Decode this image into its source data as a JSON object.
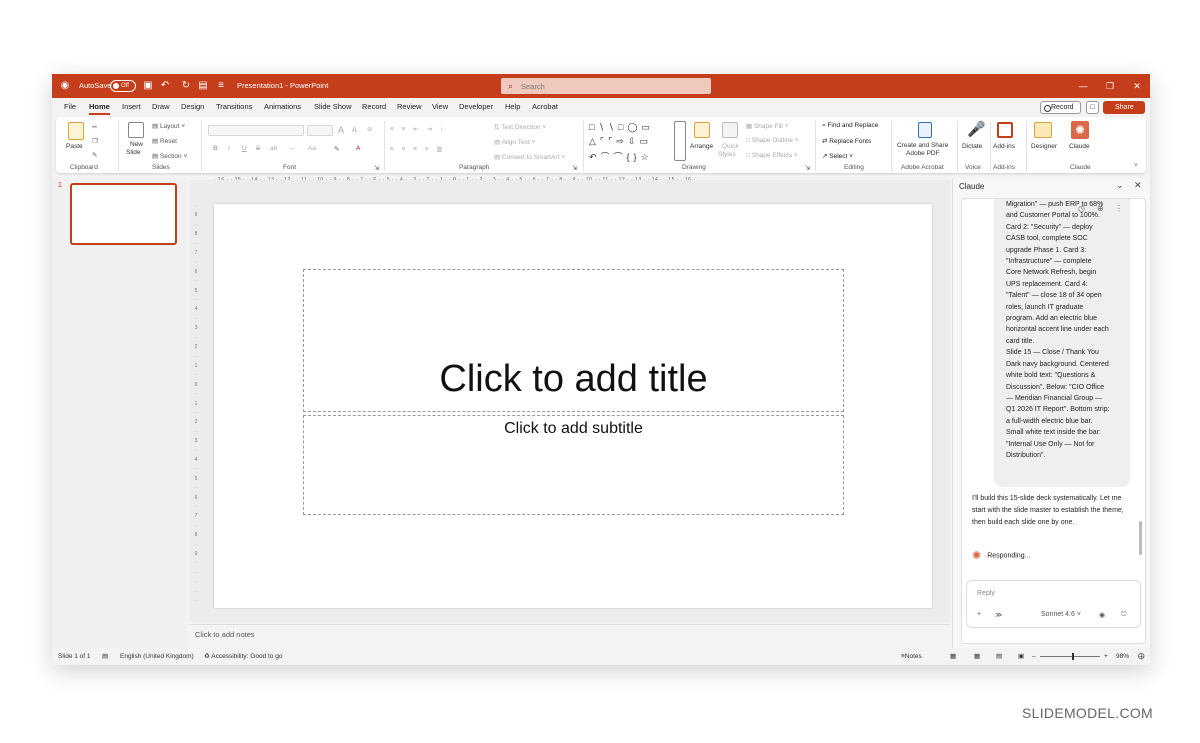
{
  "titlebar": {
    "autosave_label": "AutoSave",
    "autosave_state": "Off",
    "doc_title": "Presentation1 - PowerPoint",
    "search_placeholder": "Search"
  },
  "menu": {
    "tabs": [
      "File",
      "Home",
      "Insert",
      "Draw",
      "Design",
      "Transitions",
      "Animations",
      "Slide Show",
      "Record",
      "Review",
      "View",
      "Developer",
      "Help",
      "Acrobat"
    ],
    "active": "Home",
    "record_label": "Record",
    "share_label": "Share"
  },
  "ribbon": {
    "clipboard": {
      "paste": "Paste",
      "group": "Clipboard"
    },
    "slides": {
      "new_slide_1": "New",
      "new_slide_2": "Slide",
      "layout": "Layout",
      "reset": "Reset",
      "section": "Section",
      "group": "Slides"
    },
    "font": {
      "group": "Font",
      "bold": "B",
      "italic": "I",
      "underline": "U",
      "strike": "S",
      "grow": "A",
      "shrink": "A",
      "case": "Aa"
    },
    "paragraph": {
      "text_direction": "Text Direction",
      "align_text": "Align Text",
      "convert_smartart": "Convert to SmartArt",
      "group": "Paragraph"
    },
    "drawing": {
      "arrange": "Arrange",
      "quick_styles_1": "Quick",
      "quick_styles_2": "Styles",
      "shape_fill": "Shape Fill",
      "shape_outline": "Shape Outline",
      "shape_effects": "Shape Effects",
      "group": "Drawing"
    },
    "editing": {
      "find_replace": "Find and Replace",
      "replace_fonts": "Replace Fonts",
      "select": "Select",
      "group": "Editing"
    },
    "adobe": {
      "create_share_1": "Create and Share",
      "create_share_2": "Adobe PDF",
      "group": "Adobe Acrobat"
    },
    "voice": {
      "dictate": "Dictate",
      "group": "Voice"
    },
    "addins": {
      "addins": "Add-ins",
      "group": "Add-ins"
    },
    "designer": {
      "designer": "Designer"
    },
    "claude": {
      "claude": "Claude",
      "group": "Claude"
    }
  },
  "ruler": {
    "horizontal": "· 16 · · 15 · · 14 · · 13 · · 12 · · 11 · · 10 · · 9 · · 8 · · 7 · · 6 · · 5 · · 4 · · 3 · · 2 · · 1 · · 0 · · 1 · · 2 · · 3 · · 4 · · 5 · · 6 · · 7 · · 8 · · 9 · · 10 · · 11 · · 12 · · 13 · · 14 · · 15 · · 16 ·",
    "vertical": [
      "·",
      "9",
      "·",
      "8",
      "·",
      "7",
      "·",
      "6",
      "·",
      "5",
      "·",
      "4",
      "·",
      "3",
      "·",
      "2",
      "·",
      "1",
      "·",
      "0",
      "·",
      "1",
      "·",
      "2",
      "·",
      "3",
      "·",
      "4",
      "·",
      "5",
      "·",
      "6",
      "·",
      "7",
      "·",
      "8",
      "·",
      "9",
      "·",
      "·",
      "·",
      "·",
      "·",
      "·"
    ]
  },
  "slides_panel": {
    "slide_number": "1"
  },
  "slide": {
    "title_placeholder": "Click to add title",
    "subtitle_placeholder": "Click to add subtitle"
  },
  "notes_placeholder": "Click to add notes",
  "claude_panel": {
    "header": "Claude",
    "prompt_excerpt": "Migration\" — push ERP to 68%\nand Customer Portal to 100%.\nCard 2: \"Security\" — deploy\nCASB tool, complete SOC\nupgrade Phase 1. Card 3:\n\"Infrastructure\" — complete\nCore Network Refresh, begin\nUPS replacement. Card 4:\n\"Talent\" — close 18 of 34 open\nroles, launch IT graduate\nprogram. Add an electric blue\nhorizontal accent line under each\ncard title.\nSlide 15 — Close / Thank You\nDark navy background. Centered\nwhite bold text: \"Questions &\nDiscussion\". Below: \"CIO Office\n— Meridian Financial Group —\nQ1 2026 IT Report\". Bottom strip:\na full-width electric blue bar.\nSmall white text inside the bar:\n\"Internal Use Only — Not for\nDistribution\".",
    "assistant_reply": "I'll build this 15-slide deck systematically. Let me start with the slide master to establish the theme, then build each slide one by one.",
    "status": "Responding...",
    "reply_placeholder": "Reply",
    "model": "Sonnet 4.6"
  },
  "statusbar": {
    "slide_of": "Slide 1 of 1",
    "language": "English (United Kingdom)",
    "accessibility": "Accessibility: Good to go",
    "notes": "Notes",
    "zoom": "98%"
  },
  "watermark": "SLIDEMODEL.COM",
  "colors": {
    "accent": "#c43e1c",
    "claude_star": "#d9694a"
  }
}
